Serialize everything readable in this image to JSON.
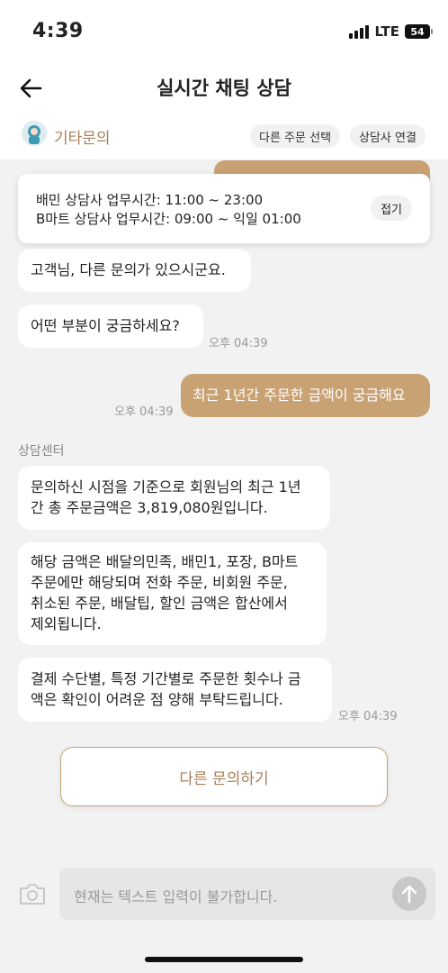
{
  "status": {
    "time": "4:39",
    "network": "LTE",
    "battery": "54"
  },
  "header": {
    "title": "실시간 채팅 상담"
  },
  "subbar": {
    "category": "기타문의",
    "select_order": "다른 주문 선택",
    "connect_agent": "상담사 연결"
  },
  "notice": {
    "line1": "배민 상담사 업무시간: 11:00 ~ 23:00",
    "line2": "B마트 상담사 업무시간: 09:00 ~ 익일 01:00",
    "fold": "접기"
  },
  "messages": {
    "bot1": "고객님, 다른 문의가 있으시군요.",
    "bot2": "어떤 부분이 궁금하세요?",
    "bot2_time": "오후 04:39",
    "user1": "최근 1년간 주문한 금액이 궁금해요",
    "user1_time": "오후 04:39",
    "sender": "상담센터",
    "bot3_l1": "문의하신 시점을 기준으로 회원님의 최근 1년",
    "bot3_l2": "간 총 주문금액은 3,819,080원입니다.",
    "bot4_l1": "해당 금액은 배달의민족, 배민1, 포장, B마트",
    "bot4_l2": "주문에만 해당되며 전화 주문, 비회원 주문,",
    "bot4_l3": "취소된 주문, 배달팁, 할인 금액은 합산에서",
    "bot4_l4": "제외됩니다.",
    "bot5_l1": "결제 수단별, 특정 기간별로 주문한 횟수나 금",
    "bot5_l2": "액은 확인이 어려운 점 양해 부탁드립니다.",
    "bot5_time": "오후 04:39"
  },
  "actions": {
    "other_inquiry": "다른 문의하기"
  },
  "input": {
    "placeholder": "현재는 텍스트 입력이 불가합니다."
  },
  "colors": {
    "accent": "#c9a274",
    "accent_text": "#a9805a",
    "background": "#f2f2f2"
  },
  "icons": {
    "back": "arrow-left-icon",
    "camera": "camera-icon",
    "send": "arrow-up-icon",
    "avatar": "cs-agent-avatar"
  }
}
